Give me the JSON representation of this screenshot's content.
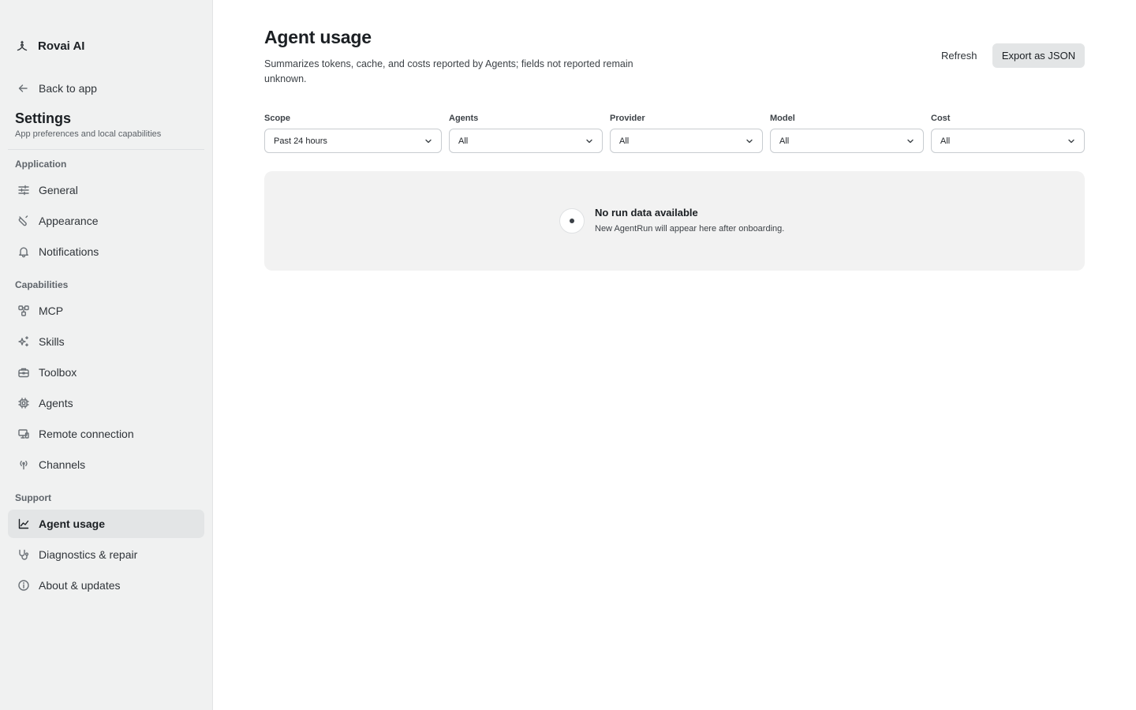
{
  "sidebar": {
    "brand": {
      "name": "Rovai AI",
      "icon": "sparkle-person-icon"
    },
    "back": {
      "label": "Back to app",
      "icon": "arrow-left-icon"
    },
    "title": "Settings",
    "subtitle": "App preferences and local capabilities",
    "sections": {
      "application": {
        "label": "Application"
      },
      "capabilities": {
        "label": "Capabilities"
      },
      "support": {
        "label": "Support"
      }
    },
    "items": {
      "general": {
        "label": "General",
        "icon": "sliders-icon"
      },
      "appearance": {
        "label": "Appearance",
        "icon": "brush-icon"
      },
      "notifications": {
        "label": "Notifications",
        "icon": "bell-icon"
      },
      "mcp": {
        "label": "MCP",
        "icon": "nodes-icon"
      },
      "skills": {
        "label": "Skills",
        "icon": "sparkles-icon"
      },
      "toolbox": {
        "label": "Toolbox",
        "icon": "briefcase-icon"
      },
      "agents": {
        "label": "Agents",
        "icon": "cpu-icon"
      },
      "remote": {
        "label": "Remote connection",
        "icon": "devices-icon"
      },
      "channels": {
        "label": "Channels",
        "icon": "broadcast-icon"
      },
      "agent_usage": {
        "label": "Agent usage",
        "icon": "chart-line-icon",
        "active": true
      },
      "diagnostics": {
        "label": "Diagnostics & repair",
        "icon": "stethoscope-icon"
      },
      "about": {
        "label": "About & updates",
        "icon": "info-icon"
      }
    }
  },
  "main": {
    "title": "Agent usage",
    "description": "Summarizes tokens, cache, and costs reported by Agents; fields not reported remain unknown.",
    "actions": {
      "refresh": "Refresh",
      "export": "Export as JSON"
    },
    "filters": {
      "scope": {
        "label": "Scope",
        "value": "Past 24 hours"
      },
      "agents": {
        "label": "Agents",
        "value": "All"
      },
      "provider": {
        "label": "Provider",
        "value": "All"
      },
      "model": {
        "label": "Model",
        "value": "All"
      },
      "cost": {
        "label": "Cost",
        "value": "All"
      }
    },
    "empty_state": {
      "title": "No run data available",
      "subtitle": "New AgentRun will appear here after onboarding."
    }
  },
  "colors": {
    "sidebar_bg": "#f0f1f1",
    "active_item_bg": "#e3e5e6",
    "export_button_bg": "#e3e5e6",
    "empty_card_bg": "#f2f2f2",
    "text_primary": "#1b1f23"
  }
}
